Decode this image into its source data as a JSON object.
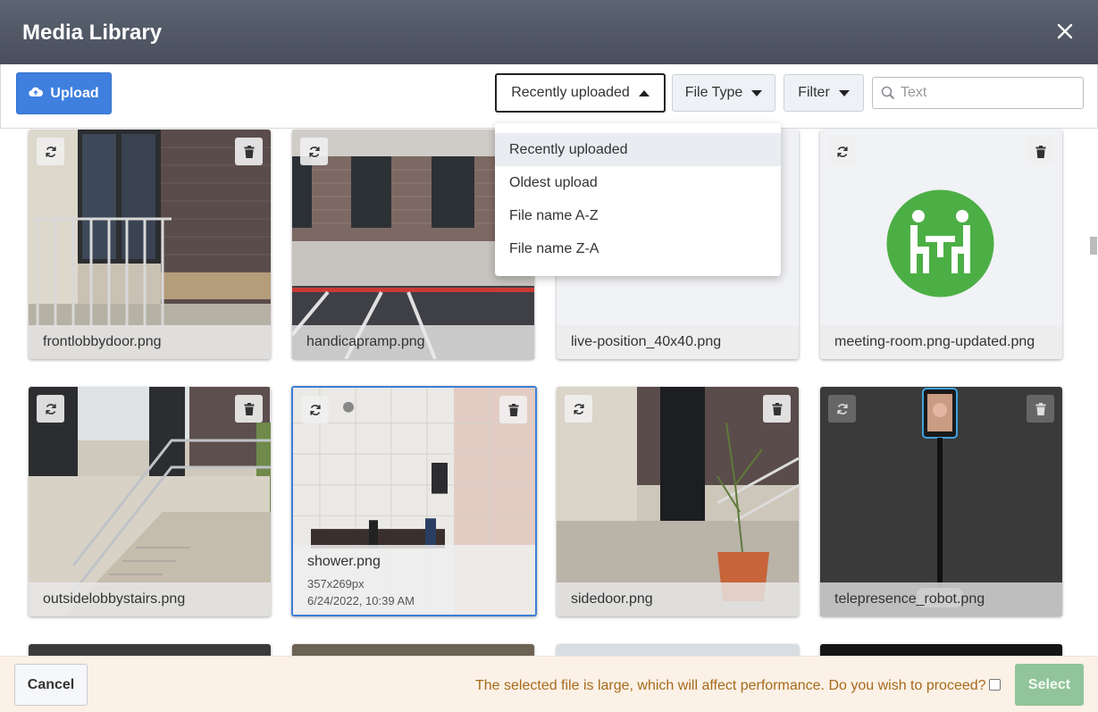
{
  "dialog": {
    "title": "Media Library"
  },
  "toolbar": {
    "upload_label": "Upload",
    "sort_label": "Recently uploaded",
    "file_type_label": "File Type",
    "filter_label": "Filter",
    "search_placeholder": "Text"
  },
  "sort_menu": {
    "options": [
      "Recently uploaded",
      "Oldest upload",
      "File name A-Z",
      "File name Z-A"
    ],
    "selected": "Recently uploaded"
  },
  "media": [
    {
      "name": "frontlobbydoor.png"
    },
    {
      "name": "handicapramp.png"
    },
    {
      "name": "live-position_40x40.png"
    },
    {
      "name": "meeting-room.png-updated.png"
    },
    {
      "name": "outsidelobbystairs.png"
    },
    {
      "name": "shower.png",
      "dimensions": "357x269px",
      "date": "6/24/2022, 10:39 AM",
      "selected": true
    },
    {
      "name": "sidedoor.png"
    },
    {
      "name": "telepresence_robot.png"
    }
  ],
  "footer": {
    "cancel_label": "Cancel",
    "warning": "The selected file is large, which will affect performance. Do you wish to proceed?",
    "select_label": "Select"
  },
  "colors": {
    "header": "#4f5664",
    "primary": "#3f7fde",
    "selected_border": "#3c7fd6",
    "select_disabled": "#91c49a",
    "warning_text": "#a76a1c",
    "meeting_icon": "#4caf45"
  }
}
